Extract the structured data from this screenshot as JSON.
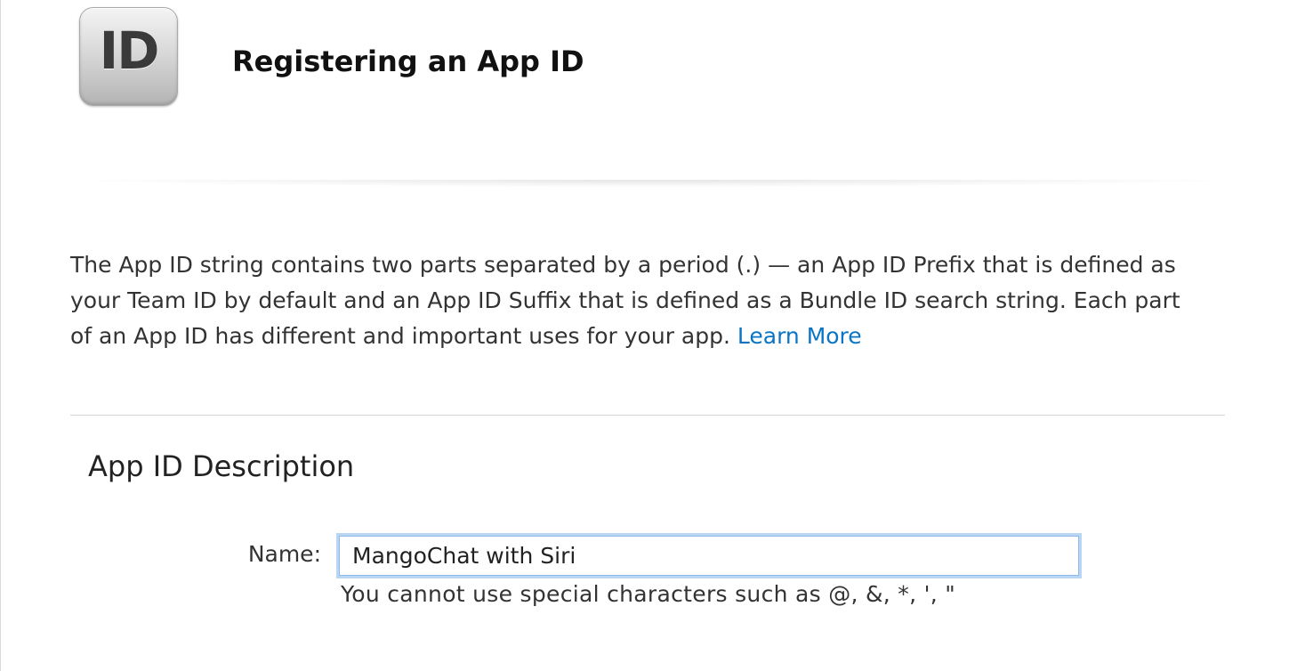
{
  "header": {
    "icon_text": "ID",
    "title": "Registering an App ID"
  },
  "intro": {
    "text": "The App ID string contains two parts separated by a period (.) — an App ID Prefix that is defined as your Team ID by default and an App ID Suffix that is defined as a Bundle ID search string. Each part of an App ID has different and important uses for your app.",
    "link_label": "Learn More",
    "link_color": "#0b74c4"
  },
  "description_section": {
    "title": "App ID Description",
    "name_label": "Name:",
    "name_value": "MangoChat with Siri",
    "help_text": "You cannot use special characters such as @, &, *, ', \""
  }
}
